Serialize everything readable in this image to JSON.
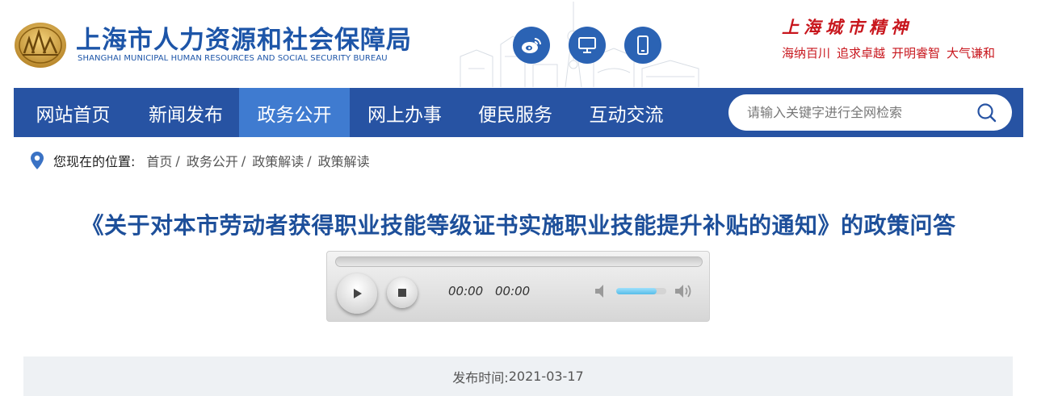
{
  "header": {
    "site_title": "上海市人力资源和社会保障局",
    "site_subtitle": "SHANGHAI MUNICIPAL HUMAN RESOURCES AND SOCIAL SECURITY BUREAU",
    "icons": [
      "weibo-icon",
      "desktop-icon",
      "mobile-icon"
    ],
    "spirit": {
      "title": "上海城市精神",
      "slogans": [
        "海纳百川",
        "追求卓越",
        "开明睿智",
        "大气谦和"
      ]
    }
  },
  "nav": {
    "items": [
      {
        "label": "网站首页",
        "active": false
      },
      {
        "label": "新闻发布",
        "active": false
      },
      {
        "label": "政务公开",
        "active": true
      },
      {
        "label": "网上办事",
        "active": false
      },
      {
        "label": "便民服务",
        "active": false
      },
      {
        "label": "互动交流",
        "active": false
      }
    ],
    "search_placeholder": "请输入关键字进行全网检索"
  },
  "breadcrumb": {
    "prefix": "您现在的位置:",
    "items": [
      "首页",
      "政务公开",
      "政策解读",
      "政策解读"
    ],
    "separator": "/"
  },
  "article": {
    "title": "《关于对本市劳动者获得职业技能等级证书实施职业技能提升补贴的通知》的政策问答",
    "publish_label": "发布时间:",
    "publish_date": "2021-03-17"
  },
  "player": {
    "current_time": "00:00",
    "duration": "00:00",
    "progress_percent": 0,
    "volume_percent": 80
  },
  "colors": {
    "brand_blue": "#1d55a8",
    "nav_bg": "#2753a3",
    "nav_active": "#3f7bd0",
    "title_blue": "#1d4f9a",
    "spirit_red": "#c8161d",
    "date_band_bg": "#eef1f4"
  }
}
